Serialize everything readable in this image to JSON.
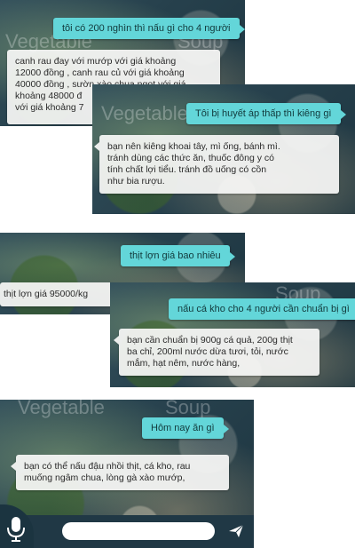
{
  "watermark": {
    "left": "Vegetable",
    "right": "Soup"
  },
  "screen1": {
    "user": "tôi có 200 nghìn thì nấu gì cho 4 người",
    "bot_lines": [
      "canh rau đay với mướp với giá khoảng",
      "12000 đồng , canh rau củ với giá khoảng",
      "40000 đồng , sườn xào chua ngọt với giá",
      "khoảng 48000 đ",
      "với giá khoảng 7"
    ]
  },
  "screen2": {
    "user": "Tôi bị huyết áp thấp thì kiêng gì",
    "bot_lines": [
      "bạn nên kiêng khoai tây, mì ống, bánh mì.",
      "tránh dùng các thức ăn, thuốc đông y có",
      "tính chất lợi tiểu. tránh đồ uống có cồn",
      "như bia rượu."
    ]
  },
  "screen3": {
    "user": "thịt lợn giá bao nhiêu",
    "bot_lines": [
      "thịt lợn giá 95000/kg"
    ]
  },
  "screen4": {
    "user": "nấu cá kho cho 4 người cần chuẩn bị gì",
    "bot_lines": [
      "bạn cần chuẩn bị 900g cá quả, 200g thịt",
      "ba chỉ, 200ml nước dừa tươi, tỏi, nước",
      "mắm, hạt nêm, nước hàng,"
    ]
  },
  "screen5": {
    "user": "Hôm nay ăn gì",
    "bot_lines": [
      "bạn có thể nấu đậu nhồi thịt, cá kho, rau",
      "muống ngâm chua, lòng gà xào mướp,"
    ]
  },
  "input": {
    "placeholder": "",
    "value": ""
  },
  "icons": {
    "mic": "microphone-icon",
    "send": "send-icon"
  }
}
